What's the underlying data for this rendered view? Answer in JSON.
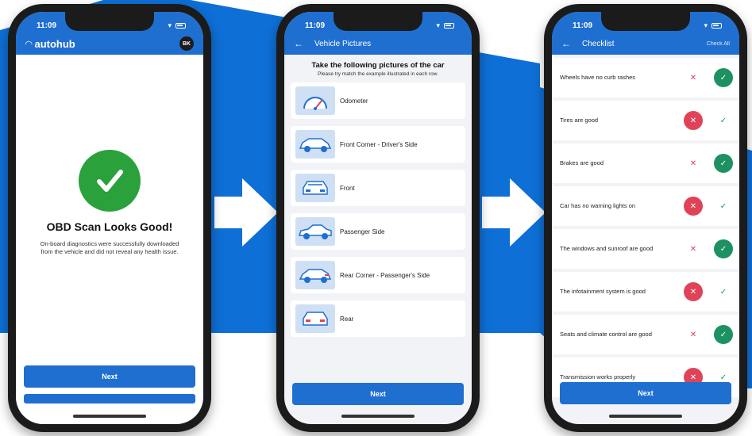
{
  "colors": {
    "brand_blue": "#1f6fd1",
    "success_green": "#2aa13b",
    "reject_red": "#e04358",
    "accept_teal": "#1e9163"
  },
  "status": {
    "time": "11:09"
  },
  "screen1": {
    "brand": "autohub",
    "avatar_initials": "BK",
    "icon": "check-icon",
    "title": "OBD Scan Looks Good!",
    "description": "On-board diagnostics were successfully downloaded from the vehicle and did not reveal any health issue.",
    "next_label": "Next"
  },
  "screen2": {
    "title": "Vehicle Pictures",
    "heading": "Take the following pictures of the car",
    "subheading": "Please try match the example illustrated in each row.",
    "items": [
      {
        "label": "Odometer",
        "icon": "odometer-icon"
      },
      {
        "label": "Front Corner - Driver's Side",
        "icon": "car-front-corner-icon"
      },
      {
        "label": "Front",
        "icon": "car-front-icon"
      },
      {
        "label": "Passenger Side",
        "icon": "car-side-icon"
      },
      {
        "label": "Rear Corner - Passenger's Side",
        "icon": "car-rear-corner-icon"
      },
      {
        "label": "Rear",
        "icon": "car-rear-icon"
      }
    ],
    "next_label": "Next"
  },
  "screen3": {
    "title": "Checklist",
    "check_all": "Check All",
    "items": [
      {
        "label": "Wheels have no curb rashes",
        "state": "yes"
      },
      {
        "label": "Tires are good",
        "state": "no"
      },
      {
        "label": "Brakes are good",
        "state": "yes"
      },
      {
        "label": "Car has no warning lights on",
        "state": "no"
      },
      {
        "label": "The windows and sunroof are good",
        "state": "yes"
      },
      {
        "label": "The infotainment system is good",
        "state": "no"
      },
      {
        "label": "Seats and climate control are good",
        "state": "yes"
      },
      {
        "label": "Transmission works properly",
        "state": "no"
      }
    ],
    "next_label": "Next"
  }
}
